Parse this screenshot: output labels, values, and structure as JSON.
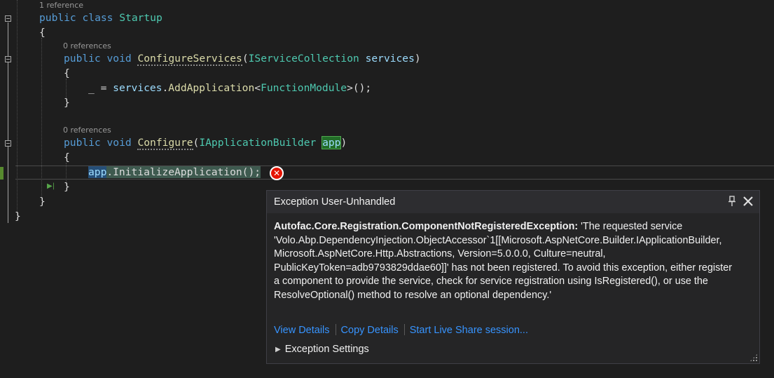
{
  "editor": {
    "lenses": {
      "startup": "1 reference",
      "configure_services": "0 references",
      "configure": "0 references"
    },
    "lines": {
      "class_kw1": "public",
      "class_kw2": "class",
      "class_name": "Startup",
      "open_brace_class": "{",
      "cs_kw1": "public",
      "cs_kw2": "void",
      "cs_method": "ConfigureServices",
      "cs_open_paren": "(",
      "cs_param_type": "IServiceCollection",
      "cs_param_name": "services",
      "cs_close_paren": ")",
      "cs_open_brace": "{",
      "add_discard": "_ =",
      "add_receiver": "services",
      "add_dot": ".",
      "add_method": "AddApplication",
      "add_lt": "<",
      "add_generic": "FunctionModule",
      "add_tail": ">();",
      "cs_close_brace": "}",
      "cfg_kw1": "public",
      "cfg_kw2": "void",
      "cfg_method": "Configure",
      "cfg_open_paren": "(",
      "cfg_param_type": "IApplicationBuilder",
      "cfg_param_name": "app",
      "cfg_close_paren": ")",
      "cfg_open_brace": "{",
      "init_receiver": "app",
      "init_call": ".InitializeApplication();",
      "cfg_close_brace": "}",
      "class_close_brace": "}",
      "ns_close_brace": "}"
    },
    "error_glyph": "✕",
    "step_glyph": "▶|"
  },
  "exception_popup": {
    "title": "Exception User-Unhandled",
    "exception_type": "Autofac.Core.Registration.ComponentNotRegisteredException:",
    "message": "'The requested service 'Volo.Abp.DependencyInjection.ObjectAccessor`1[[Microsoft.AspNetCore.Builder.IApplicationBuilder, Microsoft.AspNetCore.Http.Abstractions, Version=5.0.0.0, Culture=neutral, PublicKeyToken=adb9793829ddae60]]' has not been registered. To avoid this exception, either register a component to provide the service, check for service registration using IsRegistered(), or use the ResolveOptional() method to resolve an optional dependency.'",
    "links": [
      "View Details",
      "Copy Details",
      "Start Live Share session..."
    ],
    "settings_label": "Exception Settings",
    "pin_icon": "pin-icon",
    "close_icon": "close-icon"
  },
  "colors": {
    "background": "#1e1e1e",
    "keyword": "#569cd6",
    "type": "#4ec9b0",
    "method": "#dcdcaa",
    "parameter": "#9cdcfe",
    "link": "#3794ff",
    "error": "#e51400"
  }
}
